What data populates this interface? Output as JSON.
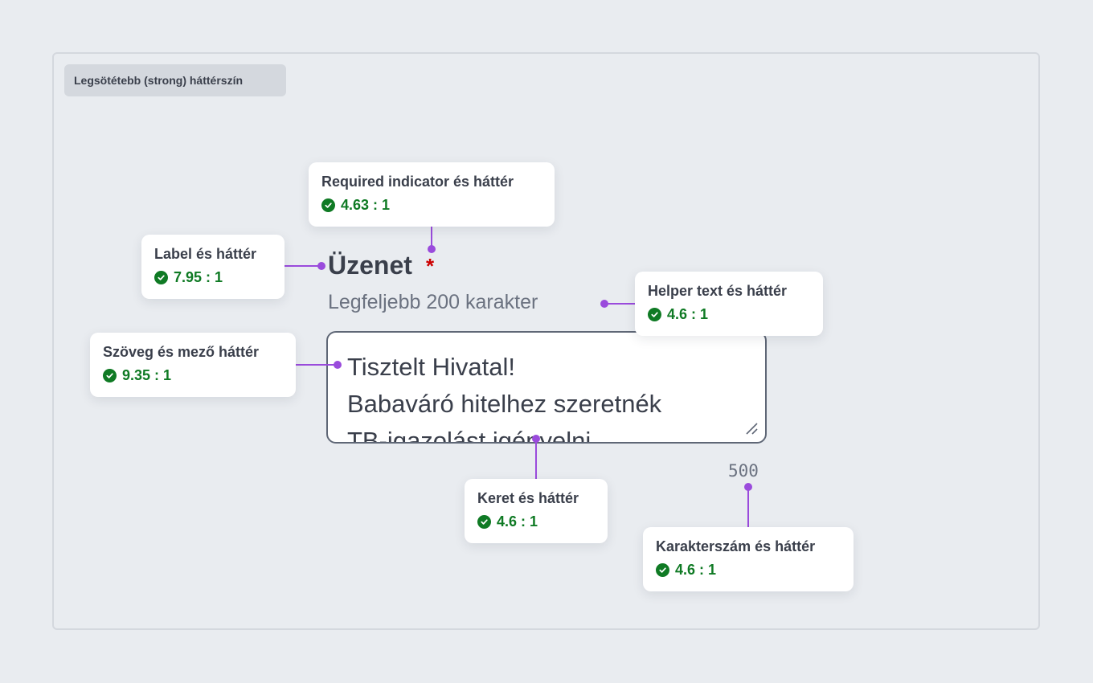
{
  "frame": {
    "tag": "Legsötétebb (strong) háttérszín"
  },
  "field": {
    "label": "Üzenet",
    "required_mark": "*",
    "helper": "Legfeljebb 200 karakter",
    "lines": [
      "Tisztelt Hivatal!",
      "Babaváró hitelhez szeretnék",
      "TB-igazolást igényelni."
    ],
    "counter": "500"
  },
  "annotations": {
    "required": {
      "title": "Required indicator és háttér",
      "ratio": "4.63 : 1"
    },
    "label": {
      "title": "Label és háttér",
      "ratio": "7.95 : 1"
    },
    "helper": {
      "title": "Helper text és háttér",
      "ratio": "4.6 : 1"
    },
    "text": {
      "title": "Szöveg és mező háttér",
      "ratio": "9.35 : 1"
    },
    "border": {
      "title": "Keret és háttér",
      "ratio": "4.6 : 1"
    },
    "counter": {
      "title": "Karakterszám és háttér",
      "ratio": "4.6 : 1"
    }
  },
  "icons": {
    "pass": "check-circle-icon",
    "resize": "resize-handle-icon"
  },
  "colors": {
    "background": "#e9ecf0",
    "connector": "#9a4bdc",
    "pass": "#0f7a24",
    "required": "#cc0000"
  }
}
